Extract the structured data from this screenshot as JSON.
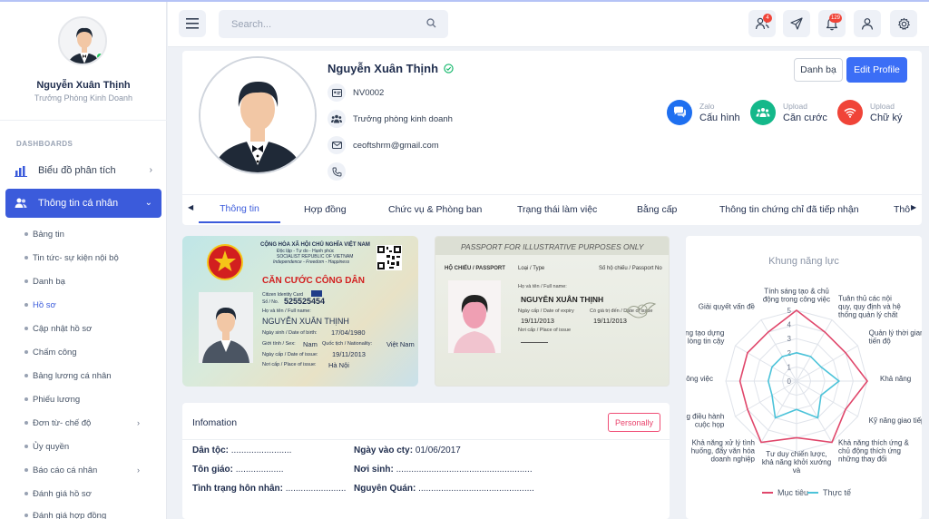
{
  "sidebar": {
    "user_name": "Nguyễn Xuân Thịnh",
    "user_role": "Trưởng Phòng Kinh Doanh",
    "section": "DASHBOARDS",
    "items": [
      {
        "label": "Biểu đồ phân tích",
        "icon": "bar-chart-icon"
      },
      {
        "label": "Thông tin cá nhân",
        "icon": "users-icon",
        "active": true
      }
    ],
    "sub_items": [
      {
        "label": "Bảng tin"
      },
      {
        "label": "Tin tức- sự kiện nội bộ"
      },
      {
        "label": "Danh bạ"
      },
      {
        "label": "Hồ sơ",
        "active": true
      },
      {
        "label": "Cập nhật hồ sơ"
      },
      {
        "label": "Chấm công"
      },
      {
        "label": "Bảng lương cá nhân"
      },
      {
        "label": "Phiếu lương"
      },
      {
        "label": "Đơn từ- chế độ",
        "has_children": true
      },
      {
        "label": "Ủy quyền"
      },
      {
        "label": "Báo cáo cá nhân",
        "has_children": true
      },
      {
        "label": "Đánh giá hồ sơ"
      },
      {
        "label": "Đánh giá hợp đồng"
      }
    ]
  },
  "header": {
    "search_placeholder": "Search...",
    "badges": {
      "users": "4",
      "notifications": "129"
    }
  },
  "profile": {
    "name": "Nguyễn Xuân Thịnh",
    "employee_id": "NV0002",
    "position": "Trưởng phòng kinh doanh",
    "email": "ceoftshrm@gmail.com",
    "btn_contacts": "Danh bạ",
    "btn_edit": "Edit Profile",
    "uploads": [
      {
        "top": "Zalo",
        "label": "Cấu hình",
        "color": "#1e6ff0"
      },
      {
        "top": "Upload",
        "label": "Căn cước",
        "color": "#14b88a"
      },
      {
        "top": "Upload",
        "label": "Chữ ký",
        "color": "#f04438"
      }
    ],
    "tabs": [
      "Thông tin",
      "Hợp đồng",
      "Chức vụ & Phòng ban",
      "Trạng thái làm việc",
      "Bằng cấp",
      "Thông tin chứng chỉ đã tiếp nhận",
      "Thô"
    ]
  },
  "id_card": {
    "line1": "CỘNG HÒA XÃ HỘI CHỦ NGHĨA VIỆT NAM",
    "line2": "Độc lập - Tự do - Hạnh phúc",
    "line3": "SOCIALIST REPUBLIC OF VIETNAM",
    "line4": "Independence - Freedom - Happiness",
    "title": "CĂN CƯỚC CÔNG DÂN",
    "subtitle": "Citizen Identity Card",
    "number_label": "Số / No.",
    "number": "525525454",
    "name_label": "Họ và tên / Full name:",
    "name": "NGUYỄN XUÂN THỊNH",
    "dob_label": "Ngày sinh / Date of birth:",
    "dob": "17/04/1980",
    "sex_label": "Giới tính / Sex:",
    "sex": "Nam",
    "nat_label": "Quốc tịch / Nationality:",
    "nat": "Việt Nam",
    "issue_label": "Ngày cấp / Date of issue:",
    "issue": "19/11/2013",
    "place_label": "Nơi cấp / Place of issue:",
    "place": "Hà Nội"
  },
  "passport": {
    "banner": "PASSPORT FOR ILLUSTRATIVE PURPOSES ONLY",
    "h1": "HỘ CHIẾU / PASSPORT",
    "h2": "Loại / Type",
    "h3": "Số hộ chiếu / Passport No",
    "name_label": "Họ và tên / Full name:",
    "name": "NGUYỄN XUÂN THỊNH",
    "issue_label": "Ngày cấp / Date of expiry",
    "issue": "19/11/2013",
    "valid_label": "Có giá trị đến / Date of issue",
    "valid": "19/11/2013",
    "place_label": "Nơi cấp / Place of issue"
  },
  "info": {
    "title": "Infomation",
    "personally": "Personally",
    "fields": {
      "ethnic_label": "Dân tộc:",
      "ethnic_dots": "........................",
      "religion_label": "Tôn giáo:",
      "religion_dots": "...................",
      "marital_label": "Tình trạng hôn nhân:",
      "marital_dots": "........................",
      "join_label": "Ngày vào cty:",
      "join_value": "01/06/2017",
      "birthplace_label": "Nơi sinh:",
      "birthplace_dots": "......................................................",
      "hometown_label": "Nguyên Quán:",
      "hometown_dots": ".............................................."
    }
  },
  "radar": {
    "title": "Khung năng lực",
    "legend_target": "Mục tiêu",
    "legend_actual": "Thực tế",
    "color_target": "#e0476b",
    "color_actual": "#4cc3d9"
  },
  "chart_data": {
    "type": "radar",
    "title": "Khung năng lực",
    "categories": [
      "Tính sáng tạo & chủ động trong công việc",
      "Tuân thủ các nội quy, quy định và hệ thống quản lý chất lượng của Công ty",
      "Quản lý thời gian và tiến độ",
      "Khả năng",
      "Kỹ năng giao tiếp",
      "Khả năng thích ứng & chủ động thích ứng những thay đổi",
      "Tư duy chiến lược, khả năng khởi xướng và",
      "Khả năng xử lý tình huống, đẩy văn hóa doanh nghiệp",
      "Kỹ năng điều hành cuộc họp",
      "công việc",
      "Khả năng tạo dựng lòng tin cậy",
      "Giải quyết vấn đề"
    ],
    "series": [
      {
        "name": "Mục tiêu",
        "values": [
          5,
          4,
          4,
          5,
          4,
          5,
          4,
          5,
          4,
          4,
          4,
          4
        ]
      },
      {
        "name": "Thực tế",
        "values": [
          2,
          2,
          2,
          3,
          2,
          3,
          2,
          3,
          2,
          2,
          2,
          2
        ]
      }
    ],
    "rlim": [
      0,
      5
    ],
    "ticks": [
      "0",
      "1",
      "2",
      "3",
      "4",
      "5"
    ],
    "legend": "bottom"
  }
}
